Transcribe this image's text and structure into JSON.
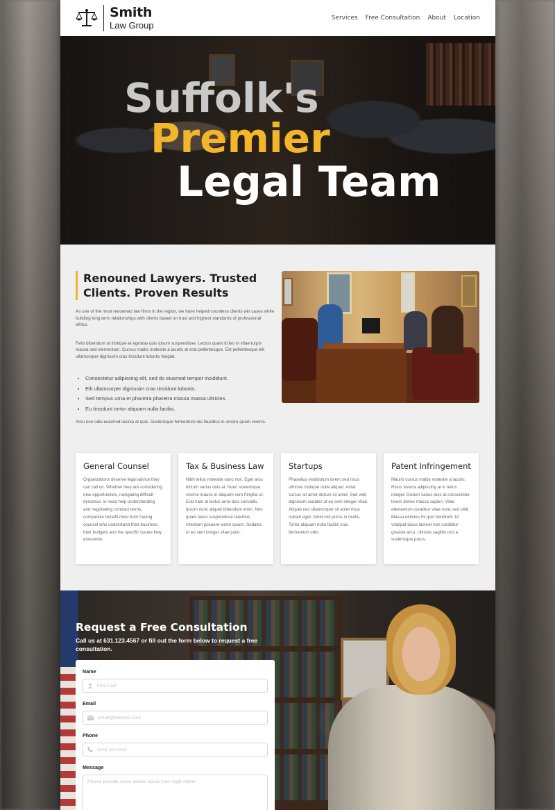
{
  "header": {
    "logo_name": "Smith",
    "logo_sub": "Law Group",
    "nav": [
      "Services",
      "Free Consultation",
      "About",
      "Location"
    ]
  },
  "hero": {
    "line1": "Suffolk's",
    "line2": "Premier",
    "line3": "Legal Team"
  },
  "about": {
    "heading": "Renouned Lawyers. Trusted Clients. Proven Results",
    "p1": "As one of the most renowned law firms in the region, we have helped countless clients win cases while building long term relationships with clients based on trust and highest standards of professional ethics.",
    "p2": "Felis bibendum ut tristique et egestas quis ipsum suspendisse. Lectus quam id leo in vitae turpis massa sed elementum. Cursus mattis molestie a iaculis at erat pellentesque. Est pellentesque elit ullamcorper dignissim cras tincidunt lobortis feugiat.",
    "bullets": [
      "Consectetur adipiscing elit, sed do eiusmod tempor incididunt.",
      "Elit ullamcorper dignissim cras tincidunt lobortis.",
      "Sed tempus urna et pharetra pharetra massa massa ultricies.",
      "Eu tincidunt tortor aliquam nulla facilisi."
    ],
    "p3": "Arcu non odio euismod lacinia at quis. Scelerisque fermentum dui faucibus in ornare quam viverra."
  },
  "services": [
    {
      "title": "General Counsel",
      "text": "Organizations deserve legal advice they can call on. Whether they are considering new opportunities, navigating difficult dynamics or need help understanding and negotiating contract terms, companies benefit most from having counsel who understand their business, their budgets and the specific issues they encounter."
    },
    {
      "title": "Tax & Business Law",
      "text": "Nibh tellus molestie nunc non. Eget arcu dictum varius duis at. Nunc scelerisque viverra mauris in aliquam sem fringilla ut. Erat nam at lectus urna duis convallis. Ipsum nunc aliquet bibendum enim. Non quam lacus suspendisse faucibus interdum posuere lorem ipsum. Sodales ut eu sem integer vitae justo."
    },
    {
      "title": "Startups",
      "text": "Phasellus vestibulum lorem sed risus ultricies tristique nulla aliquet. Amet cursus sit amet dictum sit amet. Sed velit dignissim sodales ut eu sem integer vitae. Aliquet nec ullamcorper sit amet risus nullam eget. Amet nisl purus in mollis. Tortor aliquam nulla facilisi cras fermentum odio."
    },
    {
      "title": "Patent Infringement",
      "text": "Mauris cursus mattis molestie a iaculis. Risus viverra adipiscing at in tellus integer. Dictum varius duis at consectetur lorem donec massa sapien. Vitae elementum curabitur vitae nunc sed velit. Massa ultricies mi quis hendrerit. Id volutpat lacus laoreet non curabitur gravida arcu. Ultrices sagittis orci a scelerisque purus."
    }
  ],
  "consultation": {
    "heading": "Request a Free Consultation",
    "sub": "Call us at 631.123.4567 or fill out the form below to request a free consultation.",
    "name_label": "Name",
    "name_placeholder": "First Last",
    "email_label": "Email",
    "email_placeholder": "email@address.com",
    "phone_label": "Phone",
    "phone_placeholder": "(xxx) xxx-xxxx",
    "message_label": "Message",
    "message_placeholder": "Please provide some details about your legal matter"
  },
  "colors": {
    "accent": "#f3b52a",
    "hero_line1": "#c9c9c9",
    "hero_line3": "#ffffff"
  }
}
